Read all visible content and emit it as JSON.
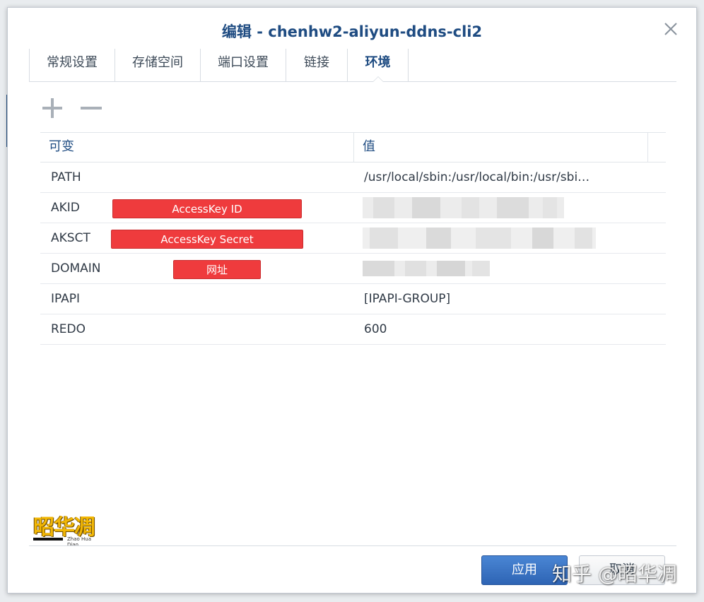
{
  "dialog": {
    "title": "编辑 - chenhw2-aliyun-ddns-cli2"
  },
  "tabs": [
    {
      "label": "常规设置",
      "active": false
    },
    {
      "label": "存储空间",
      "active": false
    },
    {
      "label": "端口设置",
      "active": false
    },
    {
      "label": "链接",
      "active": false
    },
    {
      "label": "环境",
      "active": true
    }
  ],
  "toolbar": {
    "add_icon": "plus-icon",
    "remove_icon": "minus-icon"
  },
  "table": {
    "headers": [
      "可变",
      "值"
    ],
    "rows": [
      {
        "key": "PATH",
        "value": "/usr/local/sbin:/usr/local/bin:/usr/sbi…",
        "annotation": "",
        "redacted": false
      },
      {
        "key": "AKID",
        "value": "",
        "annotation": "AccessKey ID",
        "redacted": true
      },
      {
        "key": "AKSCT",
        "value": "",
        "annotation": "AccessKey Secret",
        "redacted": true
      },
      {
        "key": "DOMAIN",
        "value": "",
        "annotation": "网址",
        "redacted": true
      },
      {
        "key": "IPAPI",
        "value": "[IPAPI-GROUP]",
        "annotation": "",
        "redacted": false
      },
      {
        "key": "REDO",
        "value": "600",
        "annotation": "",
        "redacted": false
      }
    ]
  },
  "logo": {
    "text": "昭华凋",
    "subtext": "Zhao Hua Diao"
  },
  "buttons": {
    "apply": "应用",
    "cancel": "取消"
  },
  "watermark": "知乎 @昭华凋",
  "colors": {
    "accent": "#1f4c82",
    "annotation_red": "#ef3b3d",
    "apply_blue": "#2e64b4"
  }
}
